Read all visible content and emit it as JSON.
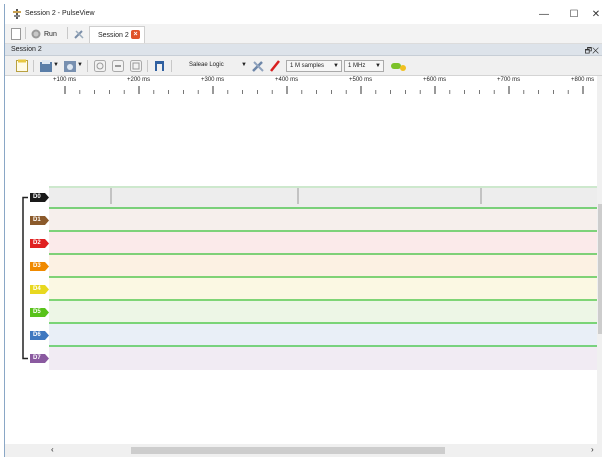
{
  "window": {
    "title": "Session 2 - PulseView",
    "controls": [
      "—",
      "☐",
      "✕"
    ]
  },
  "main_toolbar": {
    "run_label": "Run",
    "tab_label": "Session 2"
  },
  "session": {
    "title": "Session 2",
    "controls": "🗗✕"
  },
  "session_toolbar": {
    "device": "Saleae Logic",
    "samples": "1 M samples",
    "rate": "1 MHz"
  },
  "ruler": {
    "ticks": [
      "+100 ms",
      "+200 ms",
      "+300 ms",
      "+400 ms",
      "+500 ms",
      "+600 ms",
      "+700 ms",
      "+800 ms"
    ]
  },
  "channels": [
    {
      "name": "D0",
      "color": "#1a1a1a",
      "bg": "#ededed"
    },
    {
      "name": "D1",
      "color": "#8b5a2b",
      "bg": "#f6efec"
    },
    {
      "name": "D2",
      "color": "#e02020",
      "bg": "#fbeaea"
    },
    {
      "name": "D3",
      "color": "#f08a00",
      "bg": "#fcf1e3"
    },
    {
      "name": "D4",
      "color": "#e8d820",
      "bg": "#fbf8e3"
    },
    {
      "name": "D5",
      "color": "#58c21a",
      "bg": "#edf6e6"
    },
    {
      "name": "D6",
      "color": "#3f78c0",
      "bg": "#e9eff7"
    },
    {
      "name": "D7",
      "color": "#8a5aa0",
      "bg": "#f1ebf3"
    }
  ],
  "colors": {
    "trace": "#35c035",
    "accent": "#e0532a"
  }
}
